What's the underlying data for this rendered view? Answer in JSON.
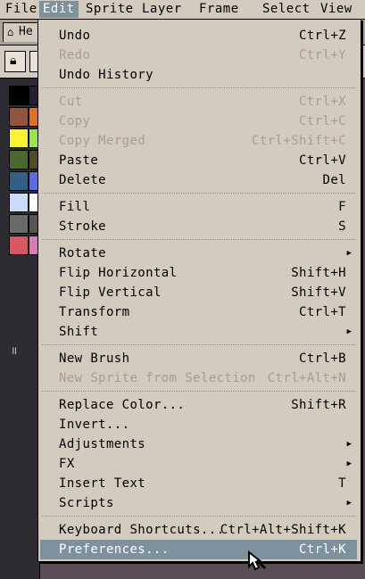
{
  "menubar": [
    {
      "label": "File",
      "active": false
    },
    {
      "label": "Edit",
      "active": true
    },
    {
      "label": "Sprite",
      "active": false
    },
    {
      "label": "Layer",
      "active": false
    },
    {
      "label": "Frame",
      "active": false
    },
    {
      "label": "Select",
      "active": false
    },
    {
      "label": "View",
      "active": false
    }
  ],
  "tab": {
    "label": "He"
  },
  "palette_colors": [
    "#000000",
    "#222034",
    "#8f563b",
    "#df7126",
    "#fbf236",
    "#99e550",
    "#4b692f",
    "#524b24",
    "#306082",
    "#5b6ee1",
    "#cbdbfc",
    "#ffffff",
    "#696a6a",
    "#595652",
    "#d95763",
    "#d77bba"
  ],
  "edit_menu": {
    "items": [
      {
        "label": "Undo",
        "shortcut": "Ctrl+Z",
        "disabled": false
      },
      {
        "label": "Redo",
        "shortcut": "Ctrl+Y",
        "disabled": true
      },
      {
        "label": "Undo History",
        "shortcut": "",
        "disabled": false
      },
      {
        "label": "Cut",
        "shortcut": "Ctrl+X",
        "disabled": true
      },
      {
        "label": "Copy",
        "shortcut": "Ctrl+C",
        "disabled": true
      },
      {
        "label": "Copy Merged",
        "shortcut": "Ctrl+Shift+C",
        "disabled": true
      },
      {
        "label": "Paste",
        "shortcut": "Ctrl+V",
        "disabled": false
      },
      {
        "label": "Delete",
        "shortcut": "Del",
        "disabled": false
      },
      {
        "label": "Fill",
        "shortcut": "F",
        "disabled": false
      },
      {
        "label": "Stroke",
        "shortcut": "S",
        "disabled": false
      },
      {
        "label": "Rotate",
        "shortcut": "",
        "submenu": true,
        "disabled": false
      },
      {
        "label": "Flip Horizontal",
        "shortcut": "Shift+H",
        "disabled": false
      },
      {
        "label": "Flip Vertical",
        "shortcut": "Shift+V",
        "disabled": false
      },
      {
        "label": "Transform",
        "shortcut": "Ctrl+T",
        "disabled": false
      },
      {
        "label": "Shift",
        "shortcut": "",
        "submenu": true,
        "disabled": false
      },
      {
        "label": "New Brush",
        "shortcut": "Ctrl+B",
        "disabled": false
      },
      {
        "label": "New Sprite from Selection",
        "shortcut": "Ctrl+Alt+N",
        "disabled": true
      },
      {
        "label": "Replace Color...",
        "shortcut": "Shift+R",
        "disabled": false
      },
      {
        "label": "Invert...",
        "shortcut": "",
        "disabled": false
      },
      {
        "label": "Adjustments",
        "shortcut": "",
        "submenu": true,
        "disabled": false
      },
      {
        "label": "FX",
        "shortcut": "",
        "submenu": true,
        "disabled": false
      },
      {
        "label": "Insert Text",
        "shortcut": "T",
        "disabled": false
      },
      {
        "label": "Scripts",
        "shortcut": "",
        "submenu": true,
        "disabled": false
      },
      {
        "label": "Keyboard Shortcuts...",
        "shortcut": "Ctrl+Alt+Shift+K",
        "disabled": false
      },
      {
        "label": "Preferences...",
        "shortcut": "Ctrl+K",
        "disabled": false,
        "selected": true
      }
    ]
  },
  "colors": {
    "menu_bg": "#d3cbbe",
    "highlight": "#7d929e",
    "disabled": "#a79d90"
  }
}
